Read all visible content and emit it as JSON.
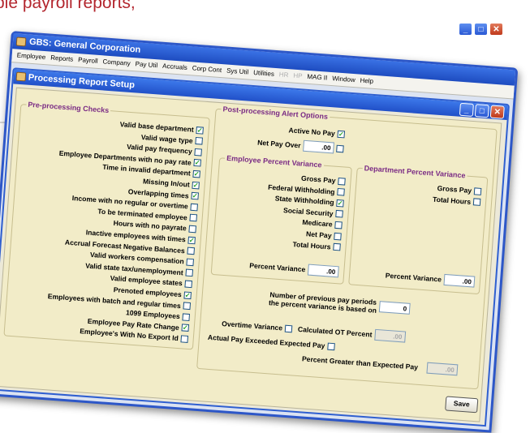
{
  "background": {
    "caption": "ple payroll reports,"
  },
  "window": {
    "title": "GBS: General Corporation",
    "controls": [
      "minimize-icon",
      "maximize-icon",
      "close-icon"
    ]
  },
  "menu": [
    {
      "label": "Employee",
      "enabled": true
    },
    {
      "label": "Reports",
      "enabled": true
    },
    {
      "label": "Payroll",
      "enabled": true
    },
    {
      "label": "Company",
      "enabled": true
    },
    {
      "label": "Pay Util",
      "enabled": true
    },
    {
      "label": "Accruals",
      "enabled": true
    },
    {
      "label": "Corp Cont",
      "enabled": true
    },
    {
      "label": "Sys Util",
      "enabled": true
    },
    {
      "label": "Utilities",
      "enabled": true
    },
    {
      "label": "HR",
      "enabled": false
    },
    {
      "label": "HP",
      "enabled": false
    },
    {
      "label": "MAG II",
      "enabled": true
    },
    {
      "label": "Window",
      "enabled": true
    },
    {
      "label": "Help",
      "enabled": true
    }
  ],
  "dialog": {
    "title": "Processing Report Setup",
    "save_label": "Save"
  },
  "pre_processing": {
    "legend": "Pre-processing Checks",
    "items": [
      {
        "label": "Valid base department",
        "checked": true
      },
      {
        "label": "Valid wage type",
        "checked": false
      },
      {
        "label": "Valid pay frequency",
        "checked": false
      },
      {
        "label": "Employee Departments with no pay rate",
        "checked": true
      },
      {
        "label": "Time in invalid department",
        "checked": true
      },
      {
        "label": "Missing In/out",
        "checked": true
      },
      {
        "label": "Overlapping times",
        "checked": true
      },
      {
        "label": "Income with no regular or overtime",
        "checked": false
      },
      {
        "label": "To be terminated employee",
        "checked": false
      },
      {
        "label": "Hours with no payrate",
        "checked": false
      },
      {
        "label": "Inactive employees with times",
        "checked": true
      },
      {
        "label": "Accrual Forecast Negative Balances",
        "checked": false
      },
      {
        "label": "Valid workers compensation",
        "checked": false
      },
      {
        "label": "Valid state tax/unemployment",
        "checked": false
      },
      {
        "label": "Valid employee states",
        "checked": false
      },
      {
        "label": "Prenoted employees",
        "checked": true
      },
      {
        "label": "Employees with batch and regular times",
        "checked": false
      },
      {
        "label": "1099 Employees",
        "checked": false
      },
      {
        "label": "Employee Pay Rate Change",
        "checked": true
      },
      {
        "label": "Employee's With No Export Id",
        "checked": false
      }
    ]
  },
  "post_processing": {
    "legend": "Post-processing Alert Options",
    "active_no_pay": {
      "label": "Active No Pay",
      "checked": true
    },
    "net_pay_over": {
      "label": "Net Pay Over",
      "value": ".00",
      "checked": false
    },
    "employee_variance": {
      "legend": "Employee Percent Variance",
      "items": [
        {
          "label": "Gross Pay",
          "checked": false
        },
        {
          "label": "Federal Withholding",
          "checked": false
        },
        {
          "label": "State Withholding",
          "checked": true
        },
        {
          "label": "Social Security",
          "checked": false
        },
        {
          "label": "Medicare",
          "checked": false
        },
        {
          "label": "Net Pay",
          "checked": false
        },
        {
          "label": "Total Hours",
          "checked": false
        }
      ],
      "percent_label": "Percent Variance",
      "percent_value": ".00"
    },
    "department_variance": {
      "legend": "Department Percent Variance",
      "items": [
        {
          "label": "Gross Pay",
          "checked": false
        },
        {
          "label": "Total Hours",
          "checked": false
        }
      ],
      "percent_label": "Percent Variance",
      "percent_value": ".00"
    },
    "previous_periods": {
      "label_line1": "Number of previous pay periods",
      "label_line2": "the percent variance is based on",
      "value": "0"
    },
    "overtime_variance": {
      "label": "Overtime Variance",
      "checked": false
    },
    "calculated_ot": {
      "label": "Calculated OT Percent",
      "value": ".00"
    },
    "actual_pay_exceeded": {
      "label": "Actual Pay Exceeded Expected Pay",
      "checked": false
    },
    "percent_greater": {
      "label": "Percent Greater than Expected Pay",
      "value": ".00"
    }
  }
}
